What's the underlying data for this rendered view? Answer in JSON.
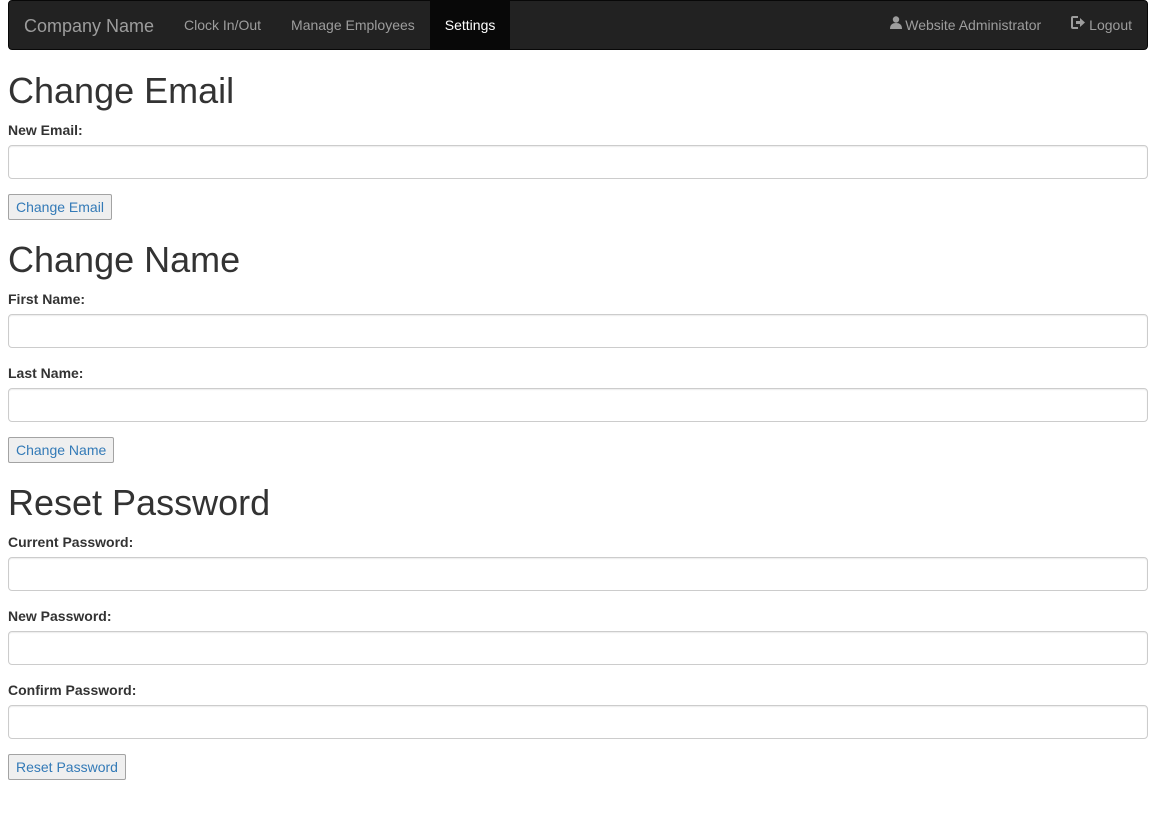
{
  "navbar": {
    "brand": "Company Name",
    "left_items": [
      {
        "label": "Clock In/Out",
        "active": false
      },
      {
        "label": "Manage Employees",
        "active": false
      },
      {
        "label": "Settings",
        "active": true
      }
    ],
    "user": {
      "label": "Website Administrator",
      "icon": "user-icon"
    },
    "logout": {
      "label": "Logout",
      "icon": "logout-icon"
    }
  },
  "change_email": {
    "heading": "Change Email",
    "new_email_label": "New Email:",
    "new_email_value": "",
    "button": "Change Email"
  },
  "change_name": {
    "heading": "Change Name",
    "first_name_label": "First Name:",
    "first_name_value": "",
    "last_name_label": "Last Name:",
    "last_name_value": "",
    "button": "Change Name"
  },
  "reset_password": {
    "heading": "Reset Password",
    "current_label": "Current Password:",
    "current_value": "",
    "new_label": "New Password:",
    "new_value": "",
    "confirm_label": "Confirm Password:",
    "confirm_value": "",
    "button": "Reset Password"
  },
  "colors": {
    "navbar_bg": "#222222",
    "navbar_active_bg": "#080808",
    "nav_text": "#9d9d9d",
    "link": "#337ab7"
  }
}
